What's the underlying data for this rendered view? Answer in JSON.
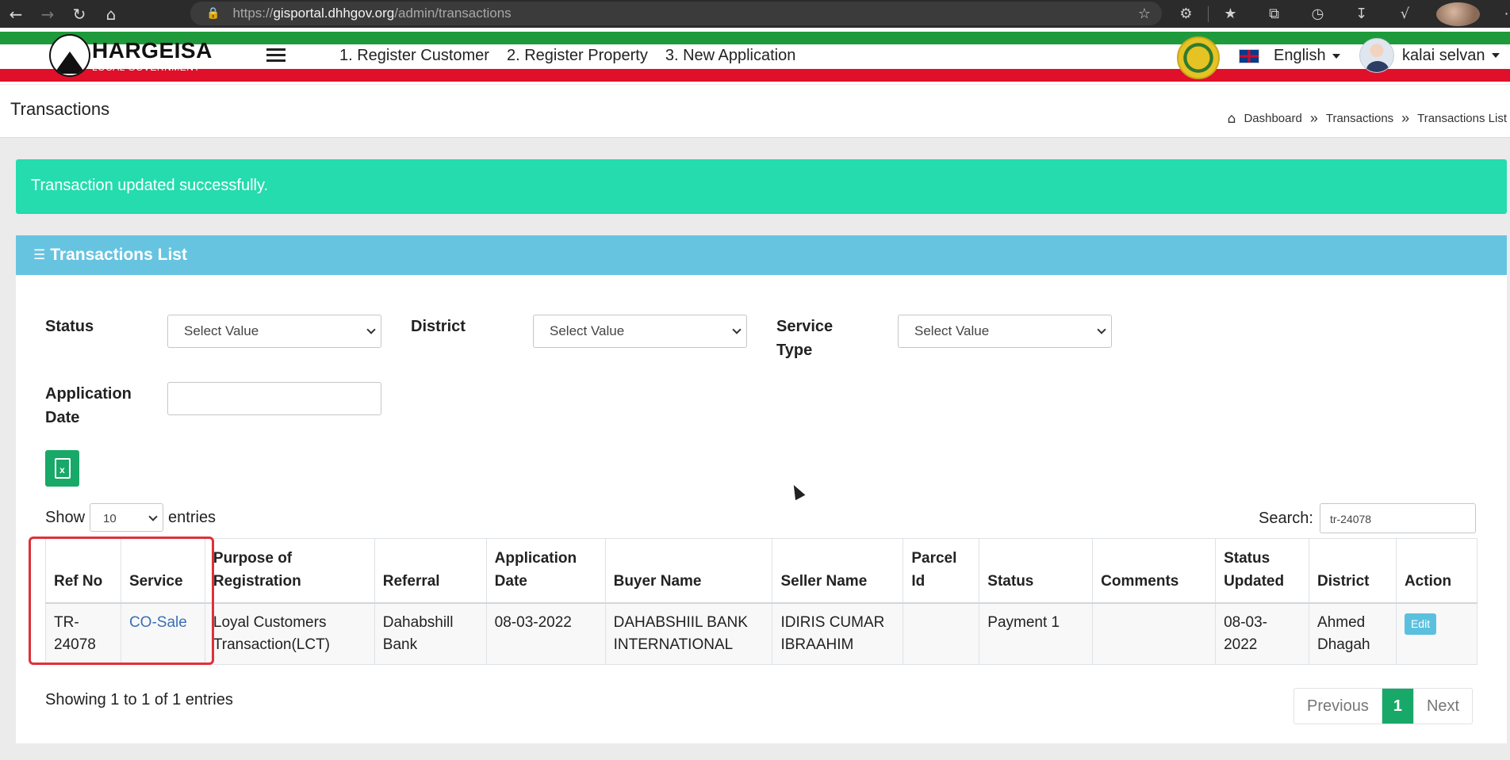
{
  "browser": {
    "url_scheme": "https://",
    "url_host": "gisportal.dhhgov.org",
    "url_path": "/admin/transactions"
  },
  "header": {
    "logo_title": "HARGEISA",
    "logo_subtitle": "LOCAL GOVERNMENT",
    "links": [
      "1. Register Customer",
      "2. Register Property",
      "3. New Application"
    ],
    "language": "English",
    "user_name": "kalai selvan"
  },
  "page": {
    "title": "Transactions",
    "breadcrumb": [
      "Dashboard",
      "Transactions",
      "Transactions List"
    ]
  },
  "alert": {
    "message": "Transaction updated successfully.",
    "color": "#24dcae"
  },
  "card": {
    "title": "Transactions List",
    "header_color": "#67c4e1"
  },
  "filters": {
    "status_label": "Status",
    "status_value": "Select Value",
    "district_label": "District",
    "district_value": "Select Value",
    "service_type_label_line1": "Service",
    "service_type_label_line2": "Type",
    "service_type_value": "Select Value",
    "application_date_label_line1": "Application",
    "application_date_label_line2": "Date",
    "application_date_value": ""
  },
  "table_controls": {
    "show_label": "Show",
    "entries_value": "10",
    "entries_label": "entries",
    "search_label": "Search:",
    "search_value": "tr-24078"
  },
  "table": {
    "headers": [
      "Ref No",
      "Service",
      "Purpose of Registration",
      "Referral",
      "Application Date",
      "Buyer Name",
      "Seller Name",
      "Parcel Id",
      "Status",
      "Comments",
      "Status Updated",
      "District",
      "Action"
    ],
    "rows": [
      {
        "ref_no": "TR-24078",
        "service": "CO-Sale",
        "purpose": "Loyal Customers Transaction(LCT)",
        "referral": "Dahabshill Bank",
        "application_date": "08-03-2022",
        "buyer_name": "DAHABSHIIL BANK INTERNATIONAL",
        "seller_name": "IDIRIS CUMAR IBRAAHIM",
        "parcel_id": "",
        "status": "Payment 1",
        "comments": "",
        "status_updated": "08-03-2022",
        "district": "Ahmed Dhagah",
        "action": "Edit"
      }
    ]
  },
  "footer": {
    "showing": "Showing 1 to 1 of 1 entries",
    "prev": "Previous",
    "page": "1",
    "next": "Next"
  },
  "colors": {
    "accent_green": "#18a868",
    "highlight_red": "#e0303a"
  }
}
